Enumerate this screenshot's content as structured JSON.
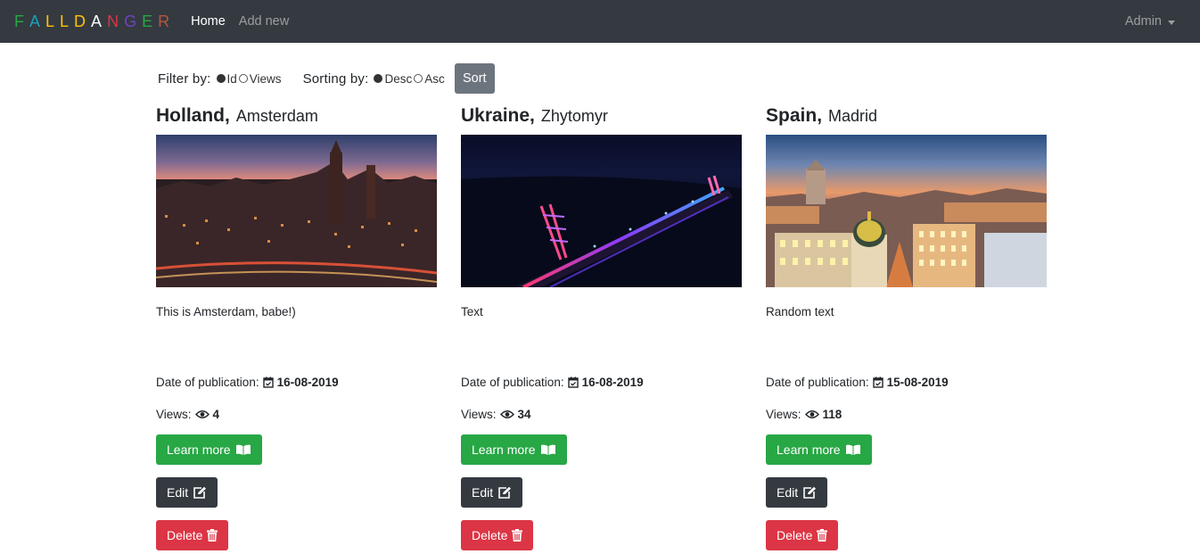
{
  "navbar": {
    "brand_letters": [
      {
        "ch": "F",
        "color": "#28a745"
      },
      {
        "ch": "A",
        "color": "#17a2b8"
      },
      {
        "ch": "L",
        "color": "#ffc107"
      },
      {
        "ch": "L",
        "color": "#ffc107"
      },
      {
        "ch": "D",
        "color": "#ffc107"
      },
      {
        "ch": "A",
        "color": "#ffffff"
      },
      {
        "ch": "N",
        "color": "#dc3545"
      },
      {
        "ch": "G",
        "color": "#6f42c1"
      },
      {
        "ch": "E",
        "color": "#28a745"
      },
      {
        "ch": "R",
        "color": "#b5553f"
      }
    ],
    "home_label": "Home",
    "add_new_label": "Add new",
    "admin_label": "Admin"
  },
  "controls": {
    "filter_label": "Filter by:",
    "filter_options": [
      "Id",
      "Views"
    ],
    "filter_selected": "Id",
    "sort_label": "Sorting by:",
    "sort_options": [
      "Desc",
      "Asc"
    ],
    "sort_selected": "Desc",
    "sort_button": "Sort"
  },
  "labels": {
    "date_prefix": "Date of publication:",
    "views_prefix": "Views:",
    "learn_more": "Learn more",
    "edit": "Edit",
    "delete": "Delete"
  },
  "cards": [
    {
      "country": "Holland",
      "city": "Amsterdam",
      "description": "This is Amsterdam, babe!)",
      "date": "16-08-2019",
      "views": "4"
    },
    {
      "country": "Ukraine",
      "city": "Zhytomyr",
      "description": "Text",
      "date": "16-08-2019",
      "views": "34"
    },
    {
      "country": "Spain",
      "city": "Madrid",
      "description": "Random text",
      "date": "15-08-2019",
      "views": "118"
    }
  ]
}
